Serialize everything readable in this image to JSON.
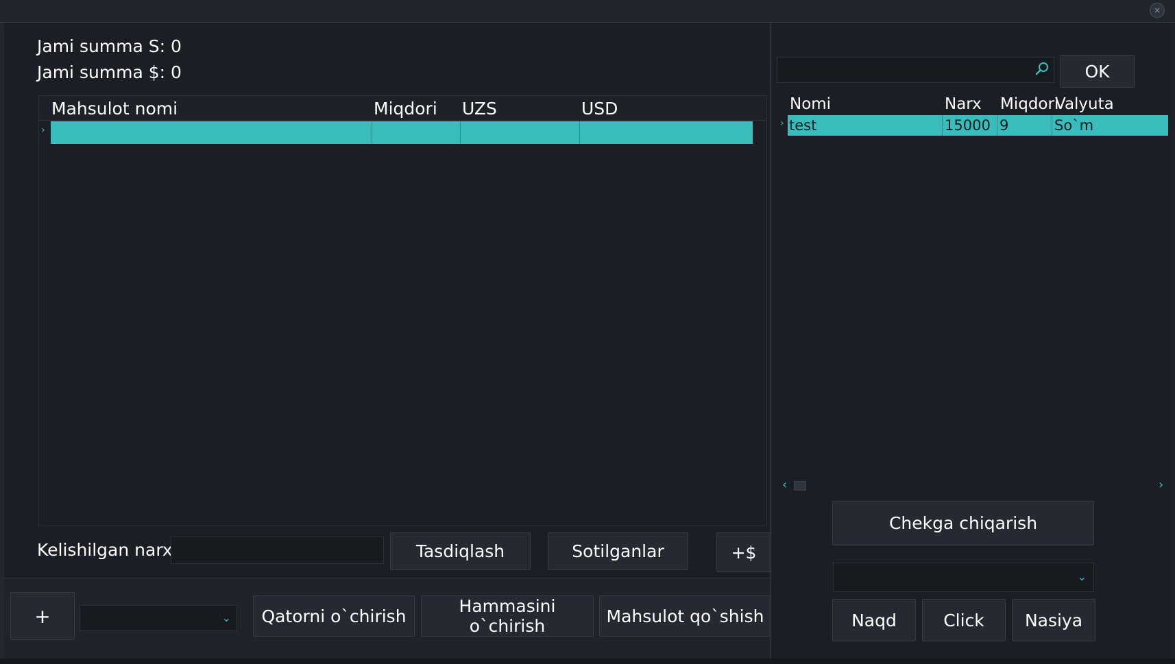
{
  "window": {
    "close_label": "×"
  },
  "summary": {
    "total_sum_label": "Jami summa S: 0",
    "total_usd_label": "Jami summa $: 0"
  },
  "cart_table": {
    "columns": [
      "Mahsulot nomi",
      "Miqdori",
      "UZS",
      "USD"
    ],
    "rows": [
      {
        "name": "",
        "qty": "",
        "uzs": "",
        "usd": ""
      }
    ],
    "row_indicator": "›"
  },
  "negotiated": {
    "label": "Kelishilgan narx",
    "value": "",
    "confirm_label": "Tasdiqlash",
    "sold_label": "Sotilganlar",
    "plus_dollar_label": "+$"
  },
  "bottom_bar": {
    "plus_label": "+",
    "combo_value": "",
    "delete_row_label": "Qatorni o`chirish",
    "delete_all_label": "Hammasini o`chirish",
    "add_product_label": "Mahsulot qo`shish"
  },
  "search": {
    "value": "",
    "icon": "search-icon",
    "ok_label": "OK"
  },
  "product_table": {
    "columns": [
      "Nomi",
      "Narx",
      "Miqdori",
      "Valyuta"
    ],
    "rows": [
      {
        "name": "test",
        "price": "15000",
        "qty": "9",
        "currency": "So`m"
      }
    ],
    "row_indicator": "›"
  },
  "actions": {
    "receipt_label": "Chekga chiqarish",
    "payment_combo_value": "",
    "cash_label": "Naqd",
    "click_label": "Click",
    "credit_label": "Nasiya"
  },
  "colors": {
    "accent": "#38bcbc",
    "background": "#1b1f25",
    "button": "#252a32"
  }
}
